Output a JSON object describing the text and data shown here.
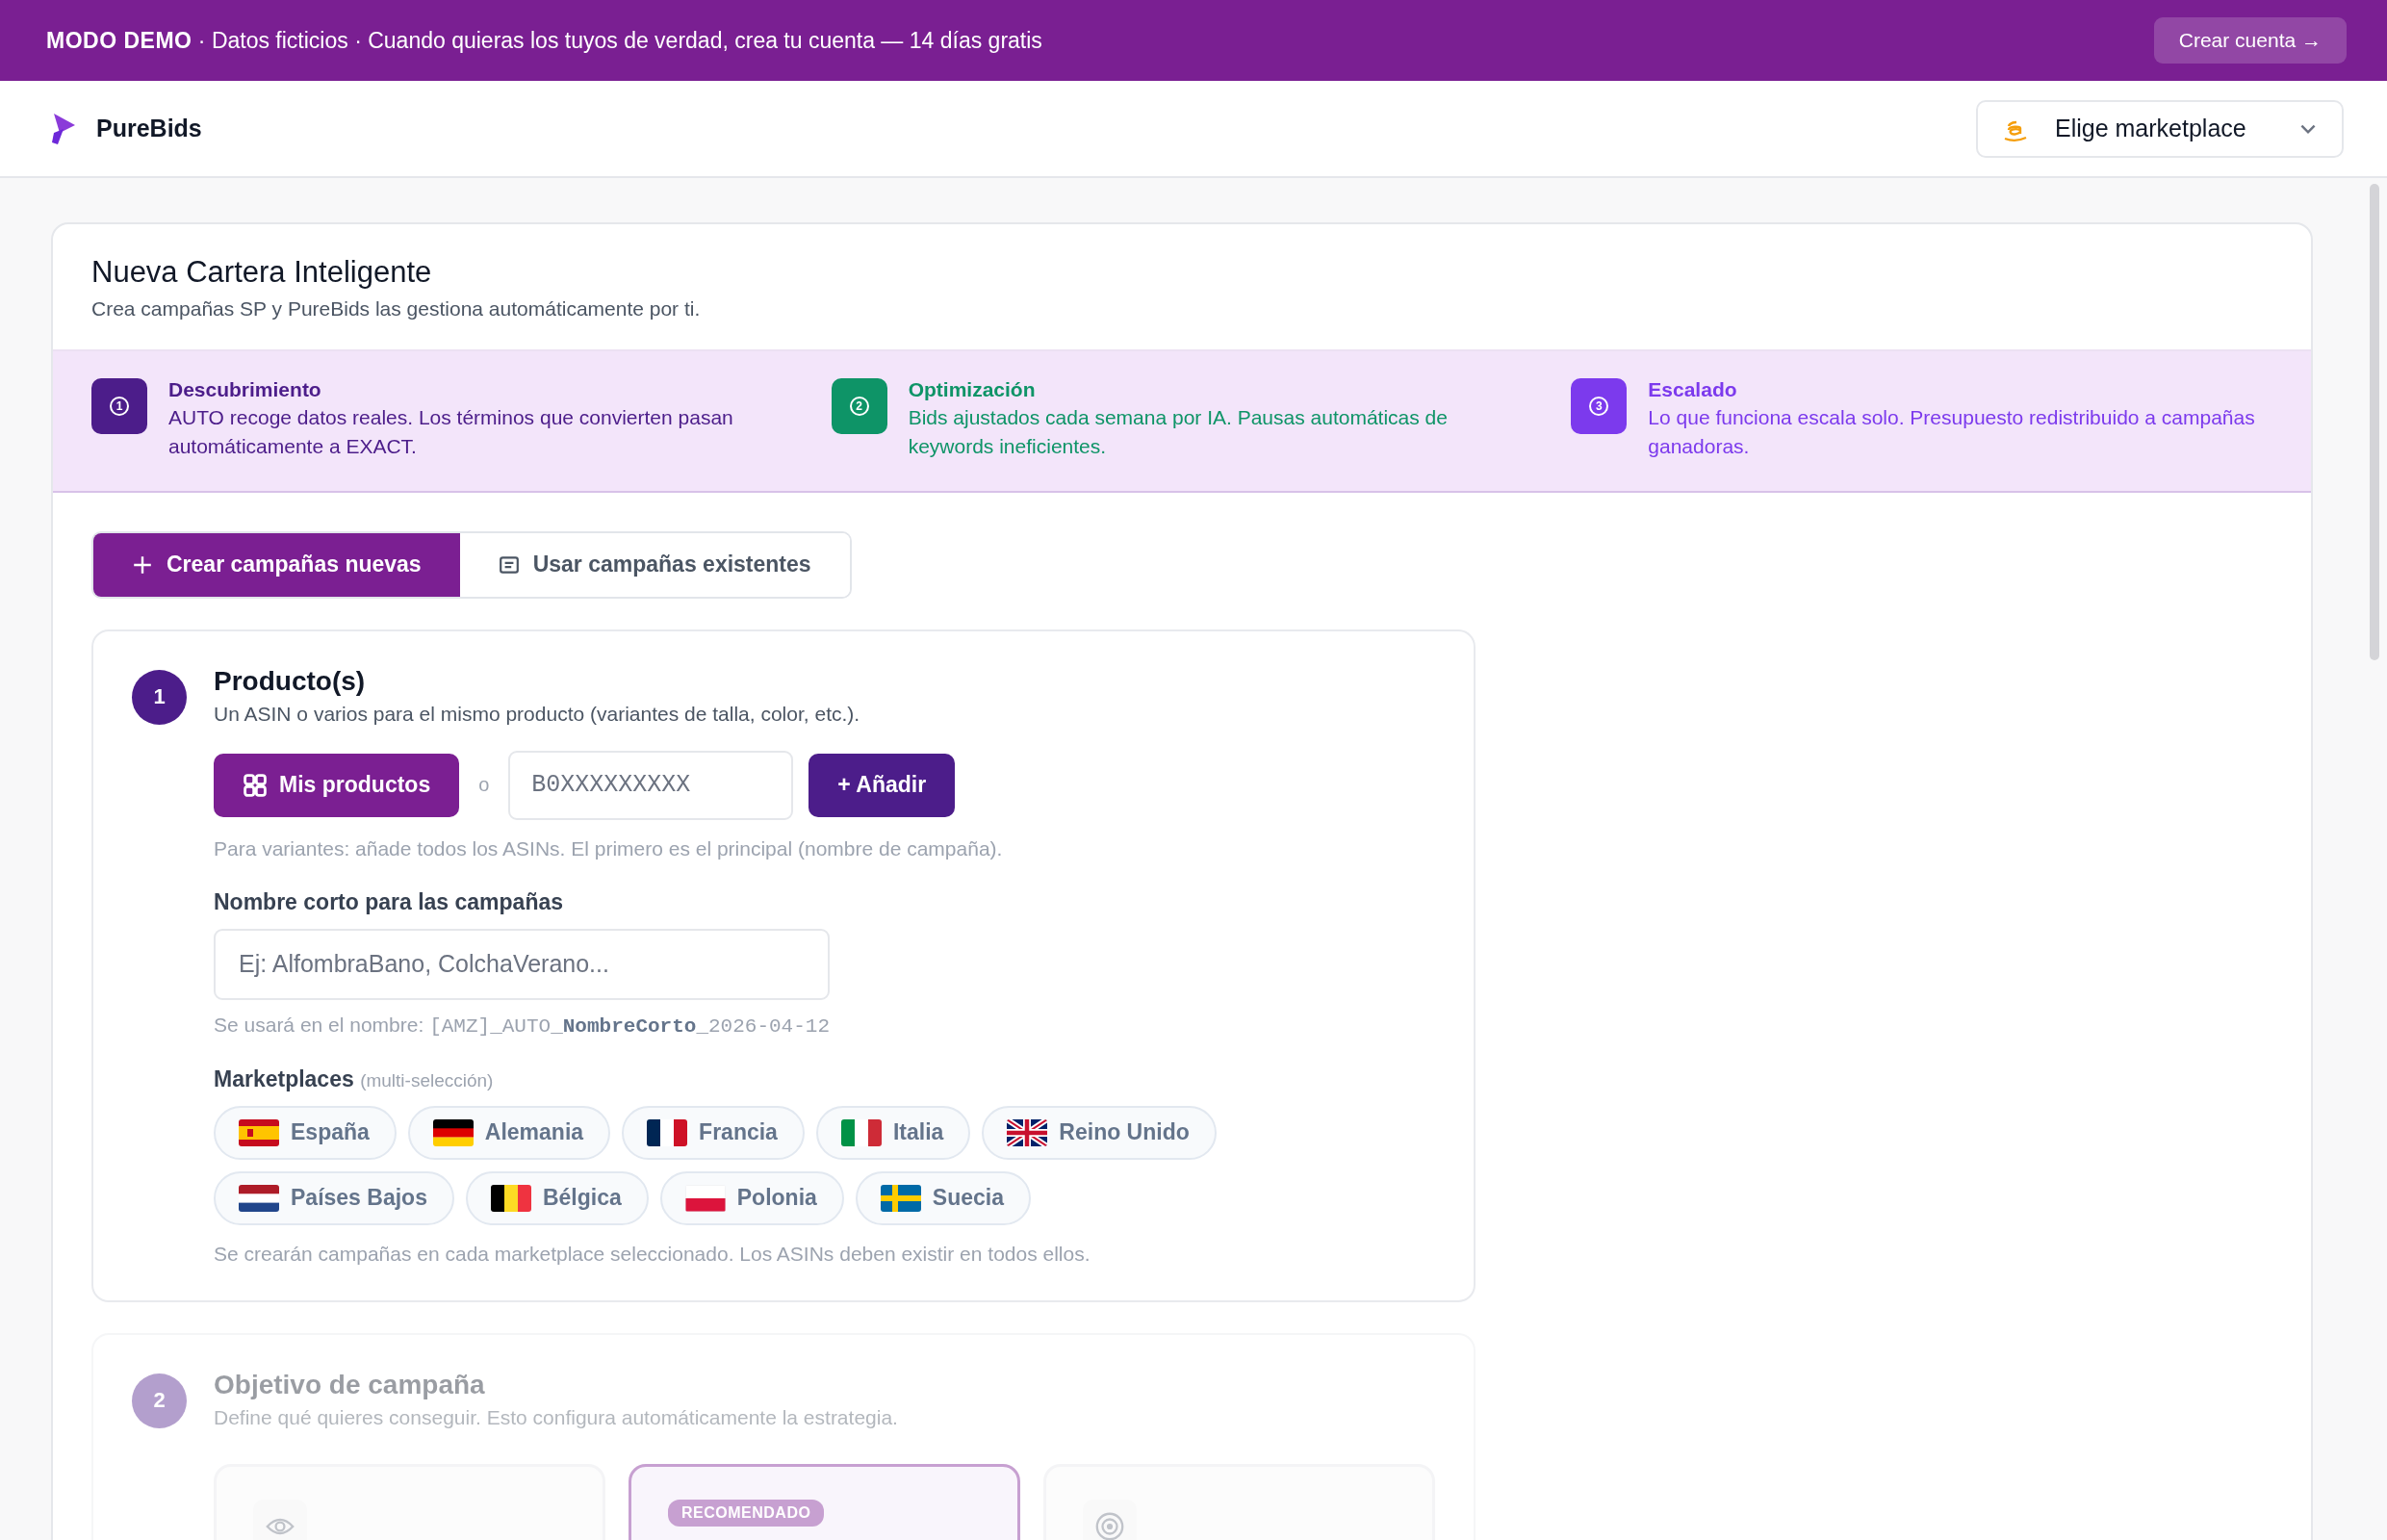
{
  "demo_banner": {
    "label": "MODO DEMO",
    "text": "· Datos ficticios · Cuando quieras los tuyos de verdad, crea tu cuenta — 14 días gratis",
    "button": "Crear cuenta →"
  },
  "header": {
    "brand": "PureBids",
    "marketplace_select": "Elige marketplace"
  },
  "page": {
    "title": "Nueva Cartera Inteligente",
    "subtitle": "Crea campañas SP y PureBids las gestiona automáticamente por ti."
  },
  "phases": [
    {
      "number": "1",
      "title": "Descubrimiento",
      "text": "AUTO recoge datos reales. Los términos que convierten pasan automáticamente a EXACT.",
      "color": "#4c1d8a"
    },
    {
      "number": "2",
      "title": "Optimización",
      "text": "Bids ajustados cada semana por IA. Pausas automáticas de keywords ineficientes.",
      "color": "#0e9467"
    },
    {
      "number": "3",
      "title": "Escalado",
      "text": "Lo que funciona escala solo. Presupuesto redistribuido a campañas ganadoras.",
      "color": "#7c3aed"
    }
  ],
  "mode_tabs": [
    {
      "label": "Crear campañas nuevas",
      "selected": true
    },
    {
      "label": "Usar campañas existentes",
      "selected": false
    }
  ],
  "steps": [
    {
      "kind": "products",
      "number": "1",
      "title": "Producto(s)",
      "subtitle": "Un ASIN o varios para el mismo producto (variantes de talla, color, etc.).",
      "disabled": false,
      "products_button": "Mis productos",
      "separator": "o",
      "asin_placeholder": "B0XXXXXXXXX",
      "add_button": "+ Añadir",
      "asin_hint": "Para variantes: añade todos los ASINs. El primero es el principal (nombre de campaña).",
      "name_label": "Nombre corto para las campañas",
      "name_placeholder": "Ej: AlfombraBano, ColchaVerano...",
      "name_hint": "Se usará en el nombre:",
      "name_pattern": "[AMZ]_AUTO_**NombreCorto**_2026-04-12",
      "marketplaces_label": "Marketplaces",
      "marketplaces_note": "(multi-selección)",
      "marketplaces": [
        {
          "name": "España",
          "selected": false
        },
        {
          "name": "Alemania",
          "selected": false
        },
        {
          "name": "Francia",
          "selected": false
        },
        {
          "name": "Italia",
          "selected": false
        },
        {
          "name": "Reino Unido",
          "selected": false
        },
        {
          "name": "Países Bajos",
          "selected": false
        },
        {
          "name": "Bélgica",
          "selected": false
        },
        {
          "name": "Polonia",
          "selected": false
        },
        {
          "name": "Suecia",
          "selected": false
        }
      ],
      "marketplaces_hint": "Se crearán campañas en cada marketplace seleccionado. Los ASINs deben existir en todos ellos."
    },
    {
      "kind": "objective",
      "number": "2",
      "title": "Objetivo de campaña",
      "subtitle": "Define qué quieres conseguir. Esto configura automáticamente la estrategia.",
      "disabled": true,
      "options": [
        {
          "selected": false
        },
        {
          "badge": "RECOMENDADO",
          "selected": true
        },
        {
          "selected": false
        }
      ]
    }
  ]
}
